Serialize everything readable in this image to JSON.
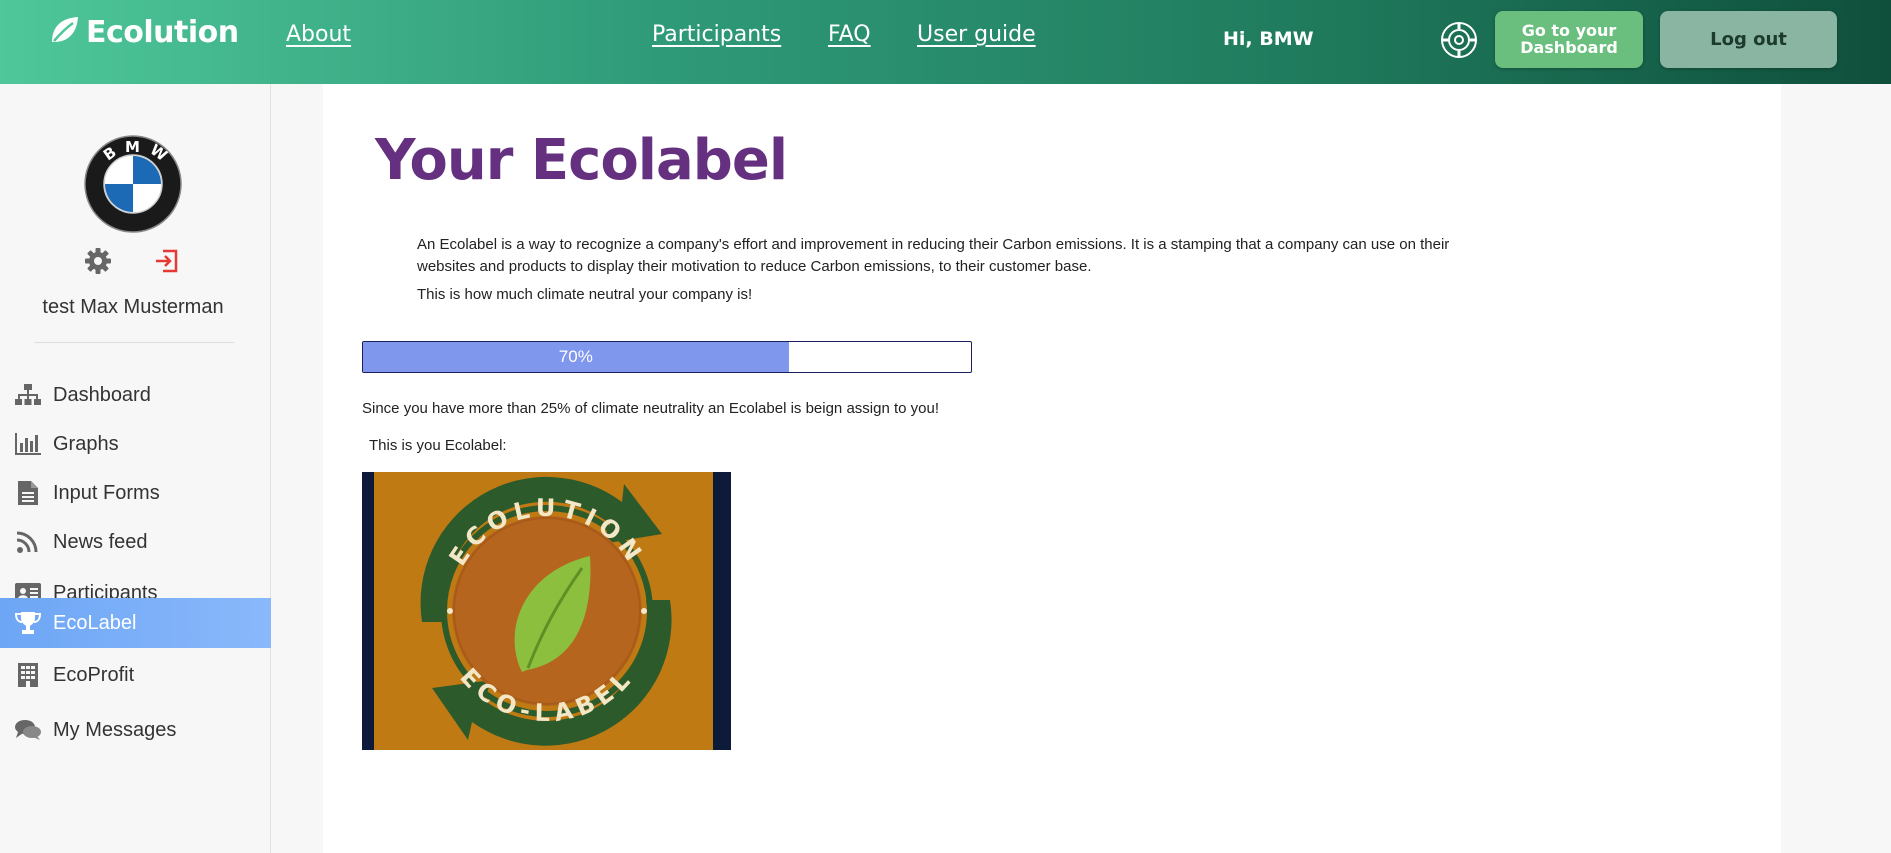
{
  "header": {
    "logo_text": "Ecolution",
    "nav": {
      "about": "About",
      "participants": "Participants",
      "faq": "FAQ",
      "user_guide": "User guide"
    },
    "greeting": "Hi, BMW",
    "dashboard_button_line1": "Go to your",
    "dashboard_button_line2": "Dashboard",
    "logout_button": "Log out"
  },
  "sidebar": {
    "avatar_text": "BMW",
    "username": "test Max Musterman",
    "items": [
      {
        "label": "Dashboard",
        "icon": "sitemap-icon"
      },
      {
        "label": "Graphs",
        "icon": "bar-chart-icon"
      },
      {
        "label": "Input Forms",
        "icon": "document-icon"
      },
      {
        "label": "News feed",
        "icon": "rss-icon"
      },
      {
        "label": "Participants",
        "icon": "id-card-icon"
      },
      {
        "label": "EcoLabel",
        "icon": "trophy-icon",
        "active": true
      },
      {
        "label": "EcoProfit",
        "icon": "building-icon"
      },
      {
        "label": "My Messages",
        "icon": "chat-icon"
      }
    ]
  },
  "main": {
    "title": "Your Ecolabel",
    "description": "An Ecolabel is a way to recognize a company's effort and improvement in reducing their Carbon emissions. It is a stamping that a company can use on their websites and products to display their motivation to reduce Carbon emissions, to their customer base.",
    "neutral_prompt": "This is how much climate neutral your company is!",
    "progress_value": 70,
    "progress_label": "70%",
    "since_text": "Since you have more than 25% of climate neutrality an Ecolabel is beign assign to you!",
    "this_is_text": "This is you Ecolabel:",
    "ecolabel_top_text": "ECOLUTION",
    "ecolabel_bottom_text": "ECO-LABEL"
  },
  "colors": {
    "title": "#64307f",
    "progress_fill": "#7f97ec",
    "active_menu": "#6da6f5",
    "dashboard_button": "#6bbf7e",
    "logout_button": "#8ab5a2"
  }
}
